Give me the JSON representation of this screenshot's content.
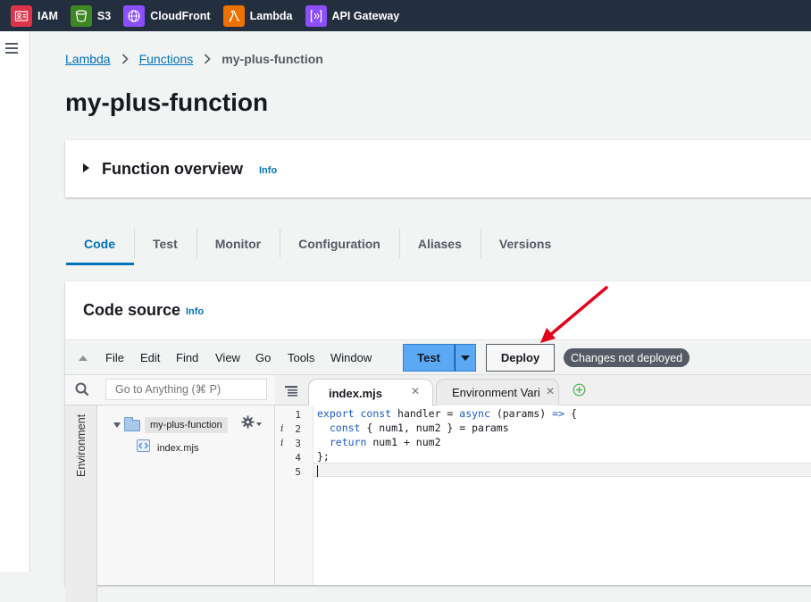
{
  "topnav": {
    "services": [
      {
        "label": "IAM",
        "icon": "iam-icon",
        "color": "#dd344c"
      },
      {
        "label": "S3",
        "icon": "s3-icon",
        "color": "#3f8624"
      },
      {
        "label": "CloudFront",
        "icon": "cloudfront-icon",
        "color": "#8c4fff"
      },
      {
        "label": "Lambda",
        "icon": "lambda-icon",
        "color": "#ed7100"
      },
      {
        "label": "API Gateway",
        "icon": "api-gateway-icon",
        "color": "#8c4fff"
      }
    ]
  },
  "breadcrumb": {
    "items": [
      "Lambda",
      "Functions"
    ],
    "current": "my-plus-function"
  },
  "page_title": "my-plus-function",
  "function_overview": {
    "title": "Function overview",
    "info": "Info"
  },
  "tabs": [
    "Code",
    "Test",
    "Monitor",
    "Configuration",
    "Aliases",
    "Versions"
  ],
  "active_tab": "Code",
  "code_source": {
    "title": "Code source",
    "info": "Info"
  },
  "toolbar": {
    "menu": [
      "File",
      "Edit",
      "Find",
      "View",
      "Go",
      "Tools",
      "Window"
    ],
    "test_label": "Test",
    "deploy_label": "Deploy",
    "status_badge": "Changes not deployed"
  },
  "file_tree": {
    "search_placeholder": "Go to Anything (⌘ P)",
    "env_label": "Environment",
    "root": "my-plus-function",
    "files": [
      "index.mjs"
    ]
  },
  "editor": {
    "tabs": [
      {
        "label": "index.mjs",
        "active": true
      },
      {
        "label": "Environment Vari",
        "active": false
      }
    ],
    "line_numbers": [
      "1",
      "2",
      "3",
      "4",
      "5"
    ],
    "info_marks": [
      "",
      "i",
      "i",
      "",
      ""
    ],
    "lines": [
      "export const handler = async (params) => {",
      "  const { num1, num2 } = params",
      "  return num1 + num2",
      "};",
      ""
    ]
  },
  "colors": {
    "accent": "#0073bb",
    "test_button": "#5ba8f5",
    "annotation_arrow": "#e3001b",
    "nav_bg": "#232f3e"
  }
}
